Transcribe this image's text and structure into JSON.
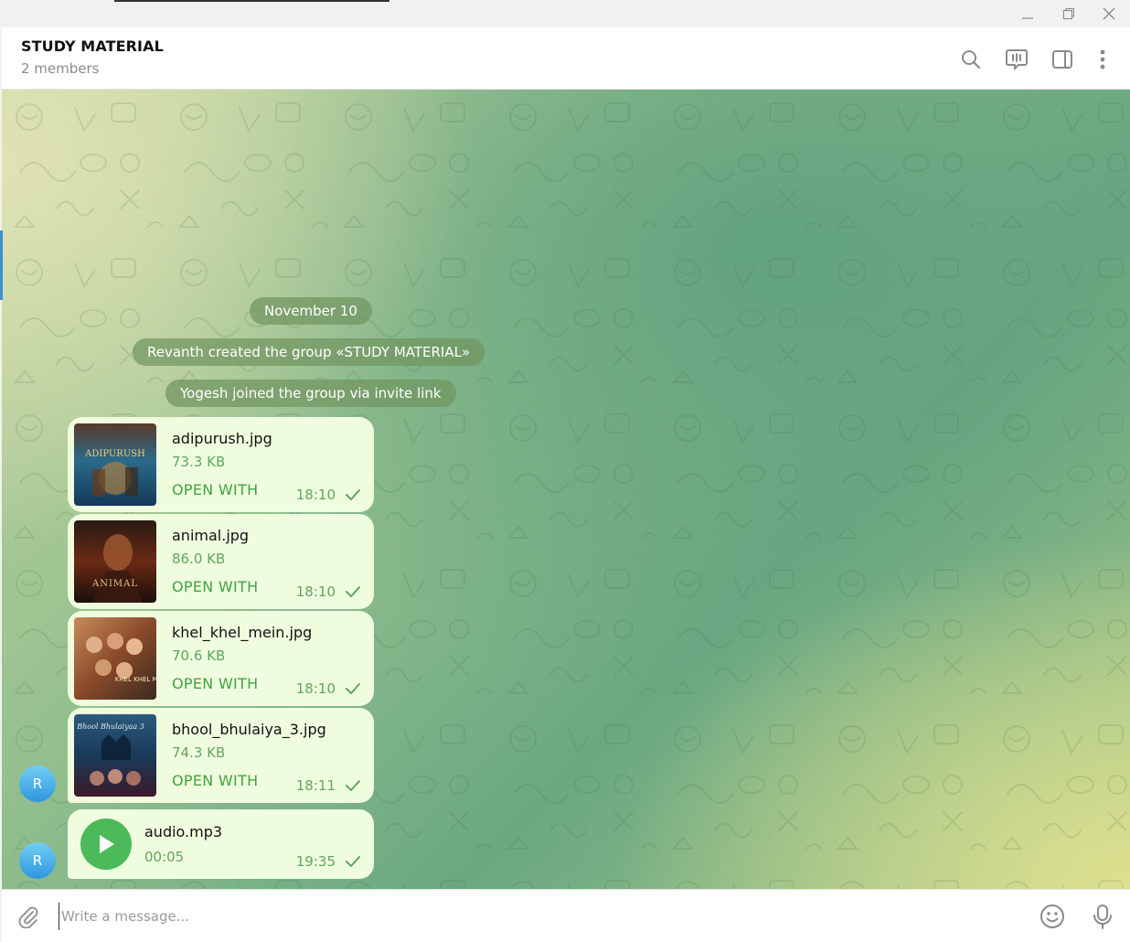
{
  "window": {
    "minimize_icon": "minimize-icon",
    "restore_icon": "restore-icon",
    "close_icon": "close-icon"
  },
  "header": {
    "title": "STUDY MATERIAL",
    "subtitle": "2 members",
    "icons": [
      "search-icon",
      "live-stream-icon",
      "side-panel-icon",
      "more-vert-icon"
    ]
  },
  "chat": {
    "date": "November 10",
    "service_messages": [
      "Revanth created the group «STUDY MATERIAL»",
      "Yogesh joined the group via invite link"
    ],
    "files": [
      {
        "name": "adipurush.jpg",
        "size": "73.3 KB",
        "action": "OPEN WITH",
        "time": "18:10",
        "thumb_text": "ADIPURUSH"
      },
      {
        "name": "animal.jpg",
        "size": "86.0 KB",
        "action": "OPEN WITH",
        "time": "18:10",
        "thumb_text": "ANIMAL"
      },
      {
        "name": "khel_khel_mein.jpg",
        "size": "70.6 KB",
        "action": "OPEN WITH",
        "time": "18:10",
        "thumb_text": "KHEL KHEL MEIN"
      },
      {
        "name": "bhool_bhulaiya_3.jpg",
        "size": "74.3 KB",
        "action": "OPEN WITH",
        "time": "18:11",
        "thumb_text": "Bhool Bhulaiyaa 3"
      }
    ],
    "audio": {
      "name": "audio.mp3",
      "duration": "00:05",
      "time": "19:35"
    },
    "avatar_letter": "R"
  },
  "composer": {
    "placeholder": "Write a message...",
    "value": "",
    "icons": [
      "attach-icon",
      "emoji-icon",
      "microphone-icon"
    ]
  },
  "colors": {
    "bubble": "#effdde",
    "accent_green": "#3fa33f",
    "service_bg": "#709460",
    "avatar": "#3aa3e6",
    "play_button": "#4cba5a"
  }
}
